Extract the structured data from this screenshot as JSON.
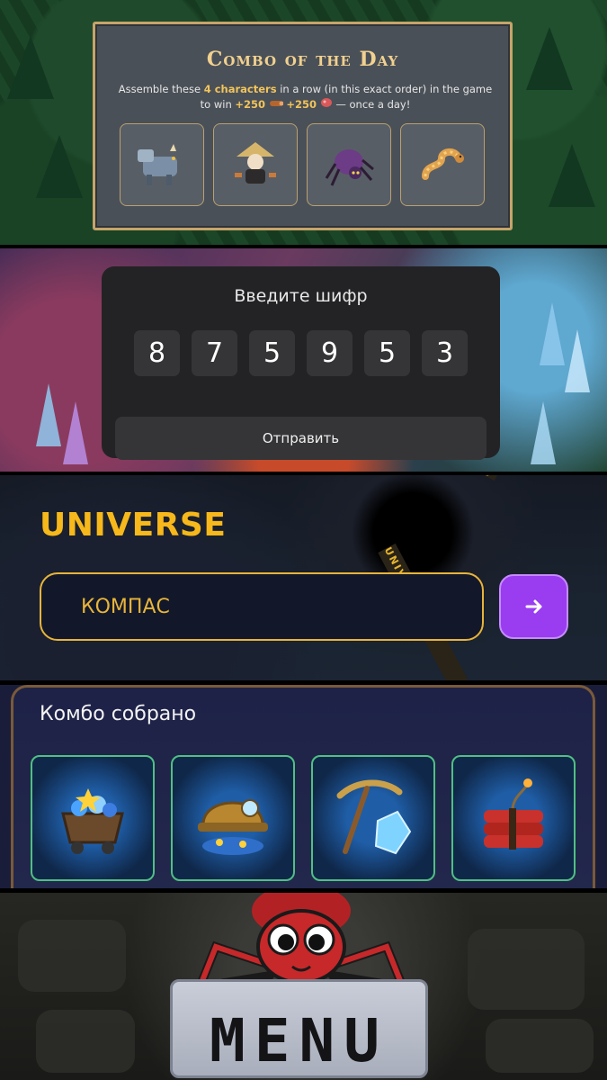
{
  "combo_of_the_day": {
    "title": "Combo of the Day",
    "desc_prefix": "Assemble these ",
    "desc_highlight": "4 characters",
    "desc_middle": " in a row (in this exact order) in the game to win ",
    "reward1": "+250",
    "reward2": "+250",
    "desc_suffix": " — once a day!",
    "characters": [
      "armored-beast-icon",
      "straw-hat-ninja-icon",
      "purple-spider-icon",
      "snake-icon"
    ]
  },
  "cipher": {
    "title": "Введите шифр",
    "digits": [
      "8",
      "7",
      "5",
      "9",
      "5",
      "3"
    ],
    "submit_label": "Отправить"
  },
  "universe": {
    "title": "UNIVERSE",
    "input_value": "КОМПАС",
    "go_icon": "arrow-right-icon",
    "tape_text": "UNIVERSE"
  },
  "combo_collected": {
    "title": "Комбо собрано",
    "cards": [
      "mine-cart-icon",
      "miner-helmet-icon",
      "pickaxe-crystal-icon",
      "dynamite-icon"
    ]
  },
  "menu": {
    "label": "MENU"
  },
  "colors": {
    "gold": "#f6b81a",
    "purple_button": "#9a3cf0",
    "card_border_green": "#4fc084"
  }
}
